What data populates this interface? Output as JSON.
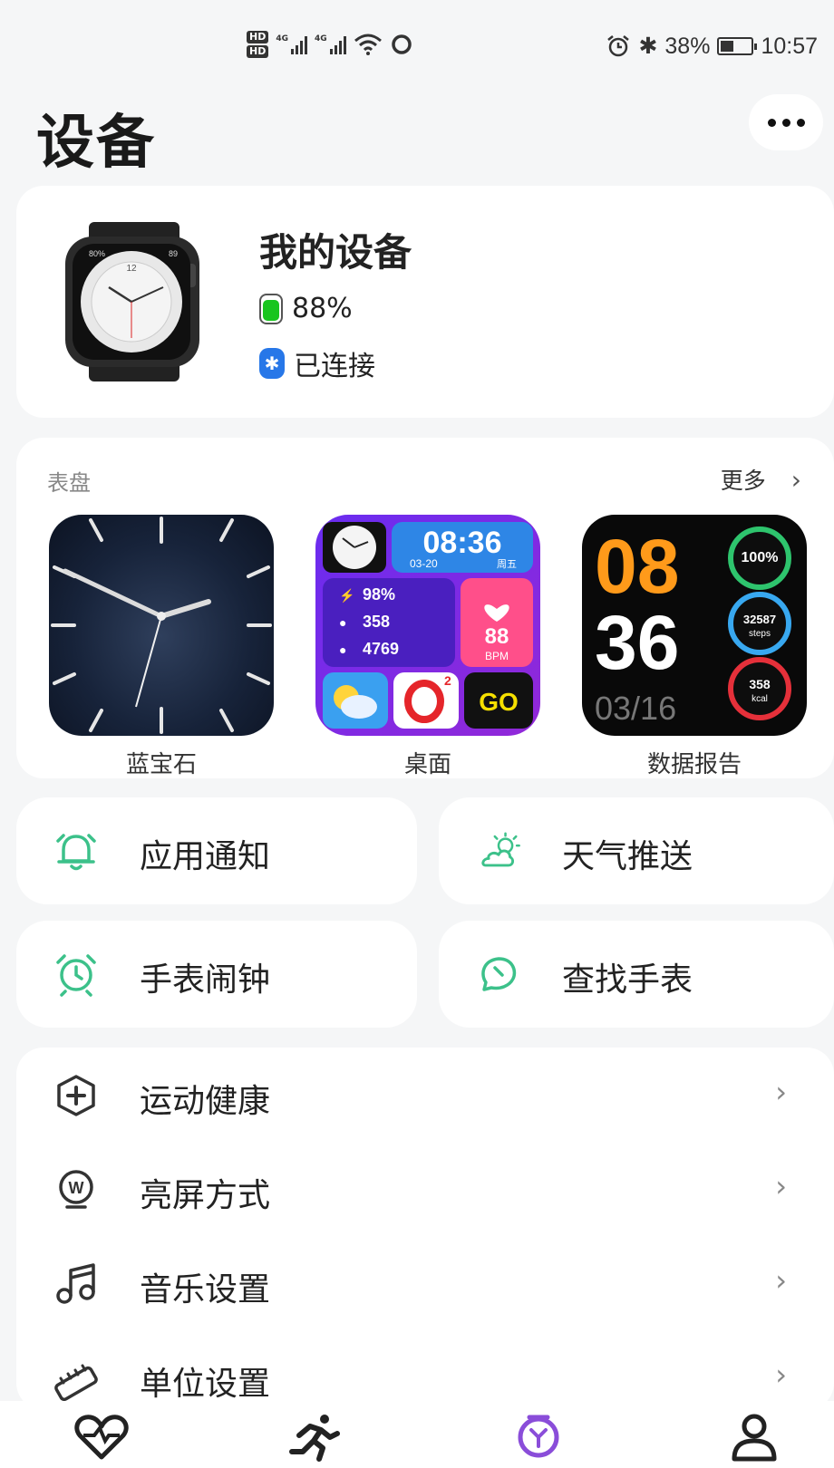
{
  "status_bar": {
    "hd1": "HD",
    "hd2": "HD",
    "net1": "4G",
    "net2": "4G",
    "bt_symbol": "✱",
    "battery_text": "38%",
    "time": "10:57",
    "icons": [
      "alarm-icon",
      "bluetooth-icon",
      "wifi-icon",
      "signal-icon",
      "battery-icon"
    ]
  },
  "header": {
    "title": "设备",
    "more_icon": "more-dots-icon"
  },
  "device": {
    "name": "我的设备",
    "battery": "88%",
    "battery_level": 0.88,
    "bt_symbol": "✱",
    "status": "已连接",
    "watch_preview": {
      "battery": "80%",
      "number_12": "12",
      "date": "89"
    },
    "colors": {
      "battery_fill": "#18c51e",
      "bluetooth": "#2777e8"
    }
  },
  "faces": {
    "title": "表盘",
    "more": "更多",
    "chevron": "›",
    "items": [
      {
        "label": "蓝宝石"
      },
      {
        "label": "桌面",
        "time": "08:36",
        "date": "03-20",
        "weekday": "周五",
        "battery": "98%",
        "calories": "358",
        "steps": "4769",
        "heart": "88",
        "heart_unit": "BPM",
        "o2_sup": "2",
        "go": "GO"
      },
      {
        "label": "数据报告",
        "hour": "08",
        "minute": "36",
        "date": "03/16",
        "battery": "100%",
        "steps": "32587",
        "steps_unit": "steps",
        "kcal": "358",
        "kcal_unit": "kcal"
      }
    ]
  },
  "tiles": {
    "notify": "应用通知",
    "weather": "天气推送",
    "alarm": "手表闹钟",
    "find": "查找手表"
  },
  "settings": {
    "chevron": "›",
    "items": [
      {
        "label": "运动健康"
      },
      {
        "label": "亮屏方式"
      },
      {
        "label": "音乐设置"
      },
      {
        "label": "单位设置"
      }
    ]
  },
  "tabbar": {
    "items": [
      {
        "icon": "heart-icon"
      },
      {
        "icon": "running-icon"
      },
      {
        "icon": "watch-icon"
      },
      {
        "icon": "person-icon"
      }
    ],
    "active_color": "#8a4dd9"
  },
  "colors": {
    "accent": "#3cc18a",
    "background": "#f5f6f7"
  }
}
